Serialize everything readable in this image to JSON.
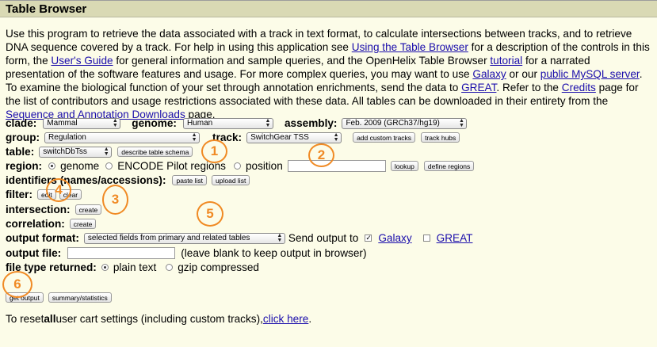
{
  "page": {
    "title": "Table Browser",
    "description_parts": {
      "p1": "Use this program to retrieve the data associated with a track in text format, to calculate intersections between tracks, and to retrieve DNA sequence covered by a track. For help in using this application see ",
      "link1": "Using the Table Browser",
      "p2": " for a description of the controls in this form, the ",
      "link2": "User's Guide",
      "p3": " for general information and sample queries, and the OpenHelix Table Browser ",
      "link3": "tutorial",
      "p4": " for a narrated presentation of the software features and usage. For more complex queries, you may want to use ",
      "link4": "Galaxy",
      "p5": " or our ",
      "link5": "public MySQL server",
      "p6": ". To examine the biological function of your set through annotation enrichments, send the data to ",
      "link6": "GREAT",
      "p7": ". Refer to the ",
      "link7": "Credits",
      "p8": " page for the list of contributors and usage restrictions associated with these data. All tables can be downloaded in their entirety from the ",
      "link8": "Sequence and Annotation Downloads",
      "p9": " page."
    }
  },
  "form": {
    "clade_label": "clade:",
    "clade_value": "Mammal",
    "genome_label": "genome:",
    "genome_value": "Human",
    "assembly_label": "assembly:",
    "assembly_value": "Feb. 2009 (GRCh37/hg19)",
    "group_label": "group:",
    "group_value": "Regulation",
    "track_label": "track:",
    "track_value": "SwitchGear TSS",
    "add_custom_tracks": "add custom tracks",
    "track_hubs": "track hubs",
    "table_label": "table:",
    "table_value": "switchDbTss",
    "describe_schema": "describe table schema",
    "region_label": "region:",
    "region_genome": "genome",
    "region_encode": "ENCODE Pilot regions",
    "region_position": "position",
    "position_value": "",
    "lookup": "lookup",
    "define_regions": "define regions",
    "identifiers_label": "identifiers (names/accessions):",
    "paste_list": "paste list",
    "upload_list": "upload list",
    "filter_label": "filter:",
    "filter_edit": "edit",
    "filter_clear": "clear",
    "intersection_label": "intersection:",
    "intersection_create": "create",
    "correlation_label": "correlation:",
    "correlation_create": "create",
    "output_format_label": "output format:",
    "output_format_value": "selected fields from primary and related tables",
    "send_output_to": "Send output to",
    "galaxy": "Galaxy",
    "great": "GREAT",
    "output_file_label": "output file:",
    "output_file_value": "",
    "output_file_hint": "(leave blank to keep output in browser)",
    "file_type_label": "file type returned:",
    "plain_text": "plain text",
    "gzip": "gzip compressed",
    "get_output": "get output",
    "summary_statistics": "summary/statistics",
    "reset_pre": "To reset ",
    "reset_bold": "all",
    "reset_mid": " user cart settings (including custom tracks), ",
    "reset_link": "click here",
    "reset_post": "."
  },
  "markers": [
    "1",
    "2",
    "3",
    "4",
    "5",
    "6"
  ],
  "colors": {
    "marker": "#f08a24",
    "link": "#1a0dab",
    "title_bar": "#d9d9b4",
    "background": "#fcfce8"
  }
}
